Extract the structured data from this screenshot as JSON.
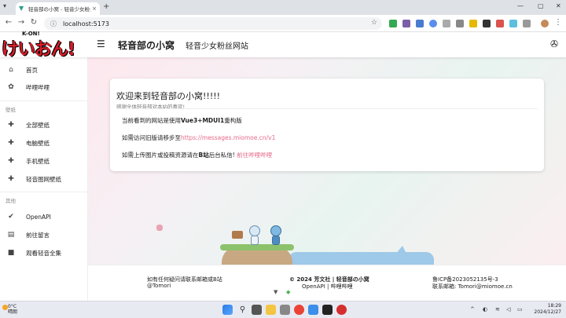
{
  "browser": {
    "tab_title": "轻音部の小窝 - 轻音少女粉丝网站",
    "url": "localhost:5173",
    "close_tab": "×",
    "new_tab": "+"
  },
  "appbar": {
    "title": "轻音部の小窝",
    "subtitle": "轻音少女粉丝网站"
  },
  "logo": {
    "kon": "K-ON!",
    "big": "けいおん!"
  },
  "sidebar": {
    "items": [
      {
        "label": "首页",
        "icon": "home-icon"
      },
      {
        "label": "哔哩哔哩",
        "icon": "bilibili-icon"
      }
    ],
    "section_wallpaper": "壁纸",
    "wallpaper_items": [
      {
        "label": "全部壁纸",
        "icon": "puzzle-icon"
      },
      {
        "label": "电脑壁纸",
        "icon": "puzzle-icon"
      },
      {
        "label": "手机壁纸",
        "icon": "puzzle-icon"
      },
      {
        "label": "轻音图网壁纸",
        "icon": "puzzle-icon"
      }
    ],
    "section_other": "其他",
    "other_items": [
      {
        "label": "OpenAPI",
        "icon": "shield-check-icon"
      },
      {
        "label": "前往留言",
        "icon": "message-icon"
      },
      {
        "label": "观看轻音全集",
        "icon": "video-icon"
      }
    ]
  },
  "card": {
    "title": "欢迎来到轻音部の小窝!!!!!",
    "subtitle": "感谢全体轻音部对本站的喜欢!",
    "line1_pre": "当前看到的网站是使用",
    "line1_bold": "Vue3+MDUI1",
    "line1_post": "重构版",
    "line2_pre": "如需访问旧版请移步至",
    "line2_link": "https://messages.miomoe.cn/v1",
    "line3_pre": "如需上传图片或投稿资源请在",
    "line3_bold": "B站",
    "line3_mid": "后台私信! ",
    "line3_link": "前往哔哩哔哩"
  },
  "footer": {
    "left1": "如有任何疑问请联系邮箱或B站",
    "left2": "@Tomori ",
    "center1": "© 2024 芳文社 | 轻音部の小窝",
    "center2": "OpenAPI | 哔哩哔哩",
    "right1": "鲁ICP备2023052135号-3",
    "right2": "联系邮箱: Tomori@miomoe.cn"
  },
  "taskbar": {
    "temp": "0°C",
    "weather": "晴朗",
    "time": "18:29",
    "date": "2024/12/27"
  },
  "colors": {
    "accent_pink": "#e56b8a",
    "logo_red": "#d81b28"
  }
}
